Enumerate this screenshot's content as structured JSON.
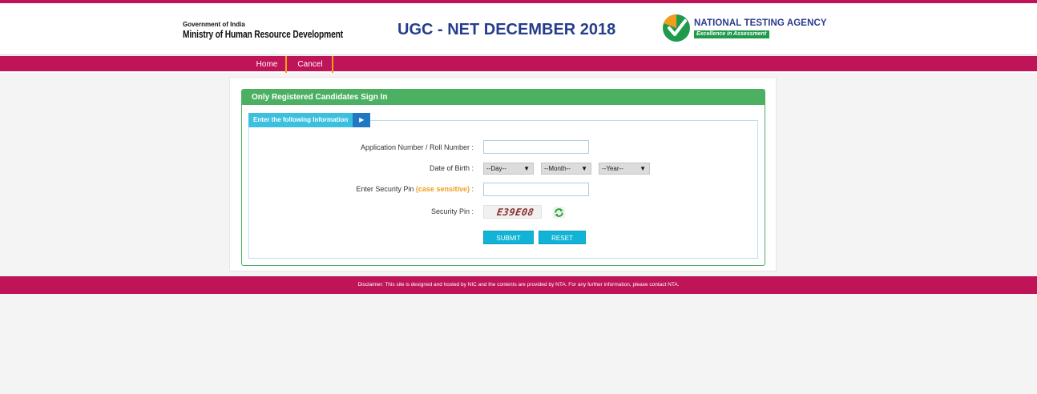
{
  "header": {
    "moe_small": "Government of India",
    "moe_big": "Ministry of Human Resource Development",
    "title": "UGC - NET DECEMBER 2018",
    "nta_title": "NATIONAL TESTING AGENCY",
    "nta_tagline": "Excellence in Assessment",
    "icons": [
      "national-emblem-icon",
      "nta-logo-icon"
    ]
  },
  "nav": {
    "items": [
      {
        "label": "Home"
      },
      {
        "label": "Cancel"
      }
    ]
  },
  "panel": {
    "title": "Only Registered Candidates Sign In",
    "legend": "Enter the following Information"
  },
  "form": {
    "application_label": "Application Number / Roll Number :",
    "application_value": "",
    "dob_label": "Date of Birth :",
    "day_selected": "--Day--",
    "month_selected": "--Month--",
    "year_selected": "--Year--",
    "security_label_main": "Enter Security Pin",
    "security_label_note": "(case sensitive)",
    "security_label_colon": ":",
    "security_value": "",
    "pin_label": "Security Pin :",
    "captcha_text": "E39E08",
    "submit_label": "SUBMIT",
    "reset_label": "RESET"
  },
  "footer": {
    "disclaimer": "Disclaimer: This site is designed and hosted by NIC and the contents are provided by NTA. For any further information, please contact NTA."
  },
  "colors": {
    "brand_magenta": "#bf1458",
    "panel_green": "#4cb062",
    "title_blue": "#263d8c",
    "button_cyan": "#11b3d6",
    "note_orange": "#f0a020"
  }
}
